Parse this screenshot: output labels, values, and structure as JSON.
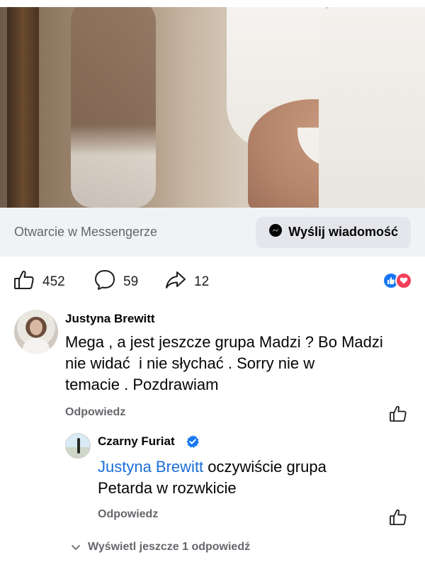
{
  "messenger_bar": {
    "label": "Otwarcie w Messengerze",
    "button_label": "Wyślij wiadomość"
  },
  "reactions": {
    "likes": "452",
    "comments": "59",
    "shares": "12",
    "badges": [
      "like-icon",
      "love-icon"
    ],
    "like_color": "#1877f2",
    "love_color": "#f33e58"
  },
  "comments": [
    {
      "author": "Justyna Brewitt",
      "text_lines": [
        "Mega , a jest jeszcze grupa Madzi ? Bo Madzi",
        "nie widać  i nie słychać . Sorry nie w",
        "temacie . Pozdrawiam"
      ],
      "reply_label": "Odpowiedz"
    },
    {
      "author": "Czarny Furiat",
      "verified": true,
      "mention": "Justyna Brewitt",
      "text_rest": " oczywiście grupa",
      "text_line2": "Petarda w rozwkicie",
      "reply_label": "Odpowiedz"
    }
  ],
  "more_replies_label": "Wyświetl jeszcze 1 odpowiedź",
  "colors": {
    "link_blue": "#1a6ed8",
    "secondary_text": "#65676b",
    "messenger_bg": "#f0f2f5"
  }
}
